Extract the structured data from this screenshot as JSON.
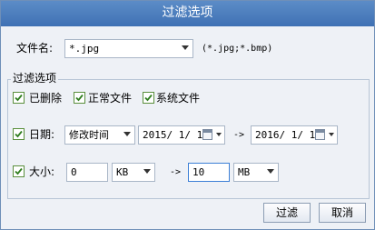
{
  "dialog": {
    "title": "过滤选项"
  },
  "filename": {
    "label": "文件名:",
    "value": "*.jpg",
    "hint": "(*.jpg;*.bmp)"
  },
  "filter_group": {
    "legend": "过滤选项"
  },
  "checkboxes": {
    "deleted": {
      "label": "已删除",
      "checked": true
    },
    "normal": {
      "label": "正常文件",
      "checked": true
    },
    "system": {
      "label": "系统文件",
      "checked": true
    }
  },
  "date": {
    "label": "日期:",
    "checked": true,
    "type_value": "修改时间",
    "from": "2015/ 1/ 1",
    "separator": "->",
    "to": "2016/ 1/ 1"
  },
  "size": {
    "label": "大小:",
    "checked": true,
    "min_value": "0",
    "min_unit": "KB",
    "separator": "->",
    "max_value": "10",
    "max_unit": "MB"
  },
  "buttons": {
    "filter": "过滤",
    "cancel": "取消"
  }
}
